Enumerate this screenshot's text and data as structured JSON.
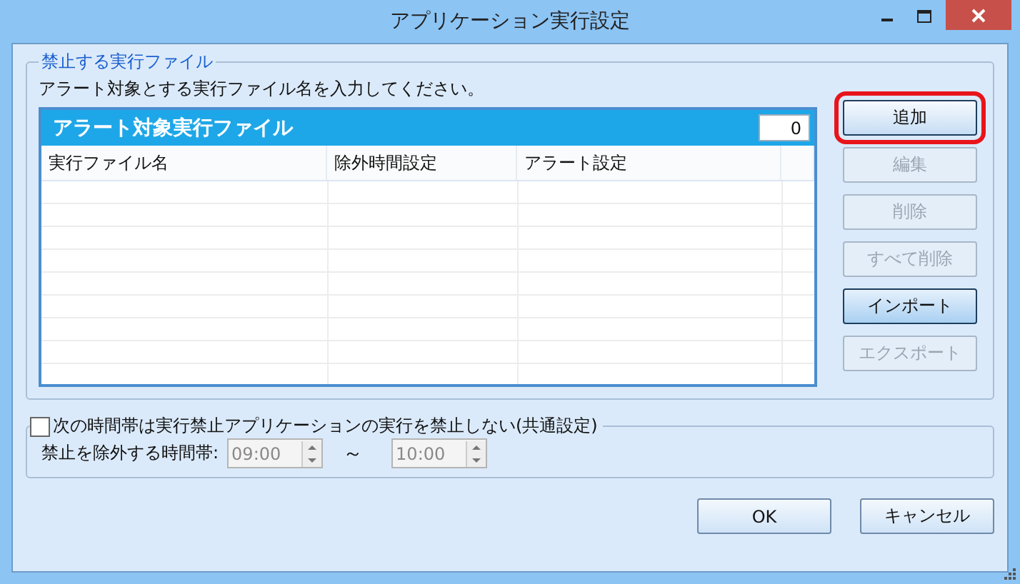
{
  "window": {
    "title": "アプリケーション実行設定"
  },
  "prohibited_group": {
    "legend": "禁止する実行ファイル",
    "instruction": "アラート対象とする実行ファイル名を入力してください。",
    "table": {
      "title": "アラート対象実行ファイル",
      "count": "0",
      "columns": [
        "実行ファイル名",
        "除外時間設定",
        "アラート設定"
      ]
    },
    "buttons": [
      {
        "label": "追加",
        "disabled": false,
        "highlighted": true,
        "focused": false
      },
      {
        "label": "編集",
        "disabled": true,
        "highlighted": false,
        "focused": false
      },
      {
        "label": "削除",
        "disabled": true,
        "highlighted": false,
        "focused": false
      },
      {
        "label": "すべて削除",
        "disabled": true,
        "highlighted": false,
        "focused": false
      },
      {
        "label": "インポート",
        "disabled": false,
        "highlighted": false,
        "focused": true
      },
      {
        "label": "エクスポート",
        "disabled": true,
        "highlighted": false,
        "focused": false
      }
    ]
  },
  "time_group": {
    "checkbox": {
      "label": "次の時間帯は実行禁止アプリケーションの実行を禁止しない(共通設定)",
      "checked": false
    },
    "label": "禁止を除外する時間帯:",
    "from": {
      "value": "09:00",
      "disabled": true
    },
    "separator": "～",
    "to": {
      "value": "10:00",
      "disabled": true
    }
  },
  "footer_buttons": [
    "OK",
    "キャンセル"
  ]
}
